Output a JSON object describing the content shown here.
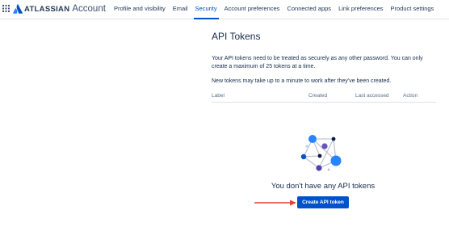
{
  "header": {
    "brand_name": "ATLASSIAN",
    "brand_product": "Account",
    "nav": [
      {
        "label": "Profile and visibility"
      },
      {
        "label": "Email"
      },
      {
        "label": "Security"
      },
      {
        "label": "Account preferences"
      },
      {
        "label": "Connected apps"
      },
      {
        "label": "Link preferences"
      },
      {
        "label": "Product settings"
      }
    ],
    "active_tab": "Security"
  },
  "main": {
    "title": "API Tokens",
    "description": "Your API tokens need to be treated as securely as any other password. You can only create a maximum of 25 tokens at a time.",
    "note": "New tokens may take up to a minute to work after they've been created.",
    "table": {
      "columns": [
        "Label",
        "Created",
        "Last accessed",
        "Action"
      ]
    },
    "empty_state": {
      "message": "You don't have any API tokens",
      "illustration": "network-nodes-illustration"
    },
    "create_button_label": "Create API token"
  },
  "icons": {
    "app_switcher": "grid-icon",
    "brand_logo": "atlassian-logo-icon",
    "annotation": "red-arrow-icon"
  },
  "colors": {
    "accent": "#0052cc",
    "text": "#172b4d",
    "muted": "#5e6c84",
    "annotation_arrow": "#e5432f"
  }
}
